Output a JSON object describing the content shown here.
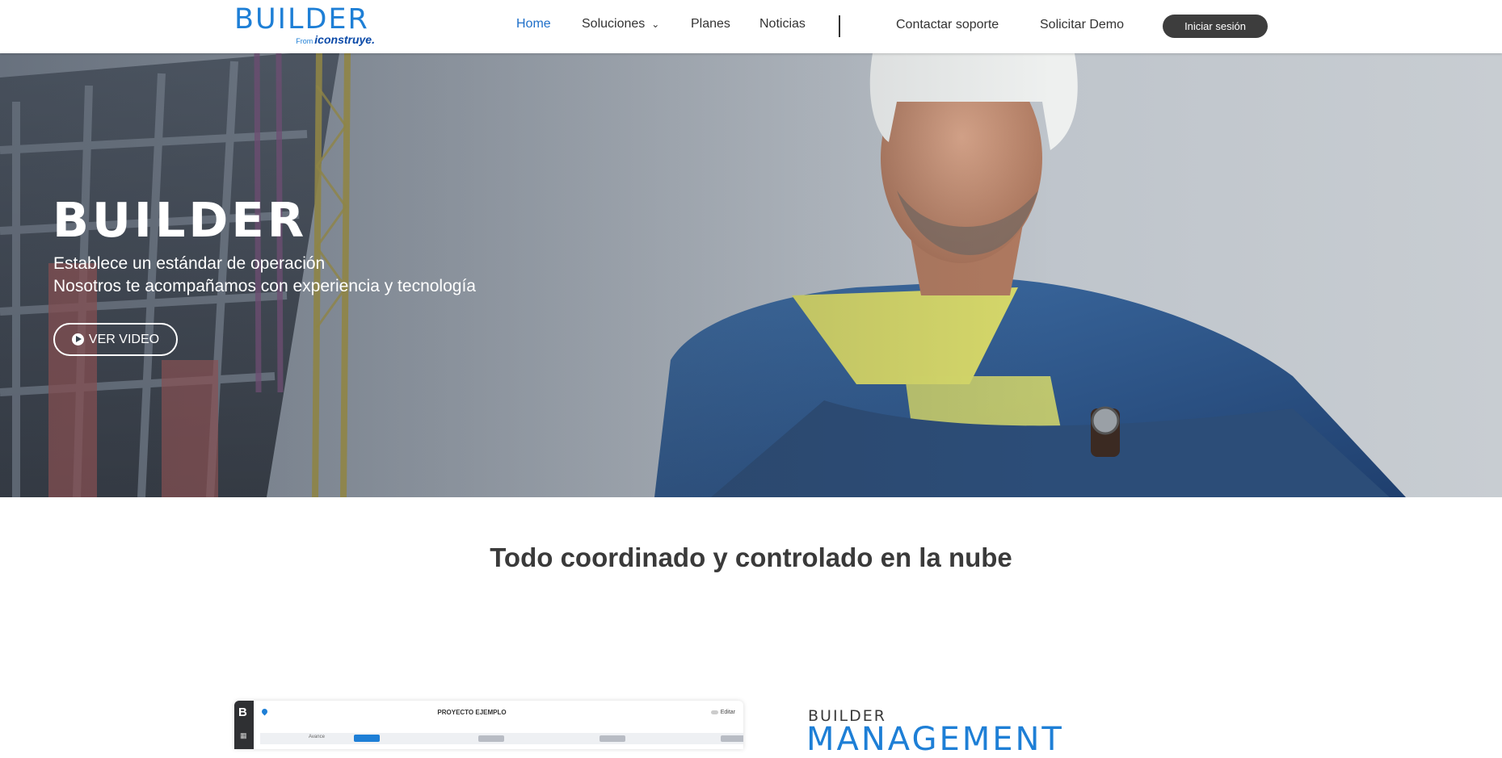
{
  "header": {
    "logo": {
      "main": "BUILDER",
      "from": "From",
      "brand": "iconstruye."
    },
    "nav": [
      {
        "label": "Home",
        "active": true
      },
      {
        "label": "Soluciones",
        "has_dropdown": true
      },
      {
        "label": "Planes"
      },
      {
        "label": "Noticias"
      }
    ],
    "support_label": "Contactar soporte",
    "demo_label": "Solicitar Demo",
    "login_label": "Iniciar sesión"
  },
  "hero": {
    "title": "BUILDER",
    "subtitle_line1": "Establece un estándar de operación",
    "subtitle_line2": "Nosotros te acompañamos con experiencia y tecnología",
    "video_button": "VER VIDEO",
    "icons": {
      "video": "play-circle-icon"
    }
  },
  "section": {
    "title": "Todo coordinado y controlado en la nube",
    "mockup": {
      "logo_letter": "B",
      "project_title": "PROYECTO EJEMPLO",
      "edit_label": "Editar",
      "tab_label": "Avance"
    },
    "product_small": "BUILDER",
    "product_big": "MANAGEMENT"
  },
  "colors": {
    "brand_blue": "#1e7fd6",
    "login_bg": "#3d3d3d",
    "active_nav": "#1e6fc9"
  }
}
